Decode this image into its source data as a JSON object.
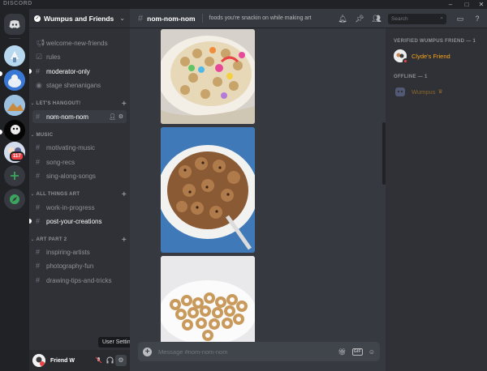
{
  "window": {
    "brand": "DISCORD",
    "controls": [
      "–",
      "□",
      "✕"
    ]
  },
  "servers": {
    "items": [
      {
        "name": "home",
        "icon": "discord-logo-icon"
      },
      {
        "name": "server-1"
      },
      {
        "name": "server-2"
      },
      {
        "name": "server-3"
      },
      {
        "name": "server-4"
      },
      {
        "name": "server-5",
        "badge": "117"
      }
    ],
    "add_icon": "plus-icon",
    "explore_icon": "compass-icon"
  },
  "guild": {
    "name": "Wumpus and Friends"
  },
  "channels": {
    "top": [
      {
        "name": "welcome-new-friends",
        "unread": false
      },
      {
        "name": "rules",
        "unread": false
      },
      {
        "name": "moderator-only",
        "unread": true
      },
      {
        "name": "stage shenanigans",
        "unread": false
      }
    ],
    "categories": [
      {
        "label": "LET'S HANGOUT!",
        "channels": [
          {
            "name": "nom-nom-nom",
            "selected": true
          }
        ]
      },
      {
        "label": "MUSIC",
        "channels": [
          {
            "name": "motivating-music"
          },
          {
            "name": "song-recs"
          },
          {
            "name": "sing-along-songs"
          }
        ]
      },
      {
        "label": "ALL THINGS ART",
        "channels": [
          {
            "name": "work-in-progress"
          },
          {
            "name": "post-your-creations",
            "unread": true
          }
        ]
      },
      {
        "label": "ART PART 2",
        "channels": [
          {
            "name": "inspiring-artists"
          },
          {
            "name": "photography-fun"
          },
          {
            "name": "drawing-tips-and-tricks"
          }
        ]
      }
    ]
  },
  "user": {
    "name": "Friend W",
    "tooltip": "User Settings"
  },
  "chat": {
    "channel": "nom-nom-nom",
    "topic": "foods you're snackin on while making art",
    "search_placeholder": "Search",
    "composer_placeholder": "Message #nom-nom-nom",
    "gif_label": "GIF"
  },
  "members": {
    "verified_header": "VERIFIED WUMPUS FRIEND — 1",
    "offline_header": "OFFLINE — 1",
    "verified": [
      {
        "name": "Clyde's Friend",
        "color": "#faa61a"
      }
    ],
    "offline": [
      {
        "name": "Wumpus",
        "color": "#7a6a3d"
      }
    ]
  }
}
